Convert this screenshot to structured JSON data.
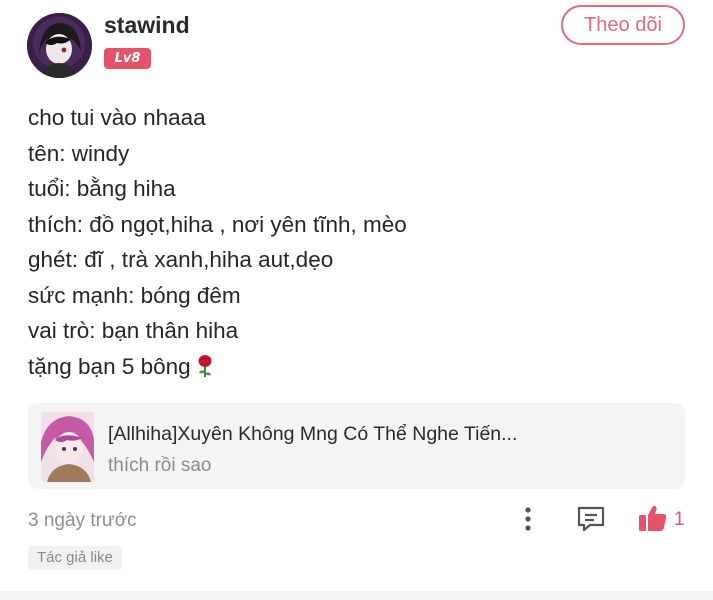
{
  "user": {
    "name": "stawind",
    "level": "Lv8"
  },
  "follow_button": {
    "label": "Theo dõi"
  },
  "comment": {
    "lines": [
      "cho tui vào nhaaa",
      "tên: windy",
      "tuổi: bằng hiha",
      "thích: đồ ngọt,hiha , nơi yên tĩnh, mèo",
      "ghét: đĩ , trà xanh,hiha aut,dẹo",
      "sức mạnh: bóng đêm",
      "vai trò: bạn thân hiha",
      "tặng bạn 5 bông"
    ],
    "emoji_icon": "rose-icon"
  },
  "book": {
    "title": "[Allhiha]Xuyên Không Mng Có Thể Nghe Tiến...",
    "subtitle": "thích rồi sao"
  },
  "footer": {
    "timestamp": "3 ngày trước",
    "like_count": "1",
    "author_like": "Tác giả like",
    "icons": [
      "more-vertical-icon",
      "reply-icon",
      "thumbs-up-icon"
    ]
  },
  "colors": {
    "accent": "#e5536a",
    "follow_border": "#e26b7a",
    "muted_text": "#8e8e8e",
    "card_bg": "#f4f4f4"
  }
}
